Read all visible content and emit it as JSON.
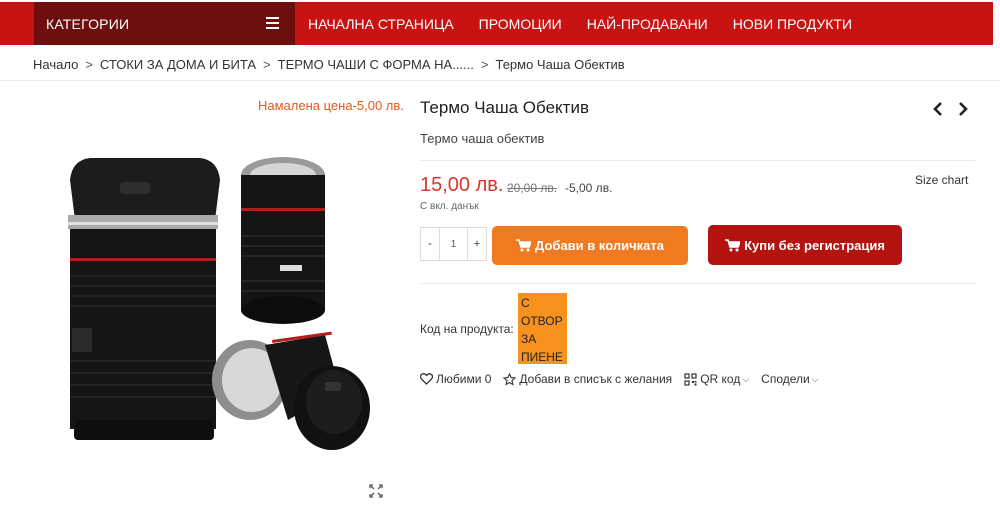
{
  "nav": {
    "categories_label": "КАТЕГОРИИ",
    "items": [
      "НАЧАЛНА СТРАНИЦА",
      "ПРОМОЦИИ",
      "НАЙ-ПРОДАВАНИ",
      "НОВИ ПРОДУКТИ"
    ]
  },
  "breadcrumb": {
    "separator": ">",
    "items": [
      "Начало",
      "СТОКИ ЗА ДОМА И БИТА",
      "ТЕРМО ЧАШИ С ФОРМА НА......",
      "Термо Чаша Обектив"
    ]
  },
  "gallery": {
    "discount_badge": "Намалена цена-5,00 лв."
  },
  "product": {
    "title": "Термо Чаша Обектив",
    "short_description": "Термо чаша обектив",
    "price_now": "15,00 лв.",
    "price_old": "20,00 лв.",
    "price_saving": "-5,00 лв.",
    "tax_note": "С вкл. данък",
    "size_chart": "Size chart",
    "quantity": "1",
    "qty_minus": "-",
    "qty_plus": "+",
    "add_to_cart": "Добави в количката",
    "buy_without_registration": "Купи без регистрация",
    "code_label": "Код на продукта:",
    "code_value_lines": [
      "С",
      "ОТВОР",
      "ЗА",
      "ПИЕНЕ"
    ]
  },
  "actions": {
    "favorites": "Любими 0",
    "wishlist": "Добави в списък с желания",
    "qr_code": "QR код",
    "share": "Сподели"
  },
  "colors": {
    "nav_red": "#c91313",
    "category_dark": "#6e0f0f",
    "price_red": "#d9362b",
    "add_button": "#f07a20",
    "buy_button": "#b4130f",
    "code_badge": "#f7921e",
    "discount_text": "#e05a17"
  }
}
